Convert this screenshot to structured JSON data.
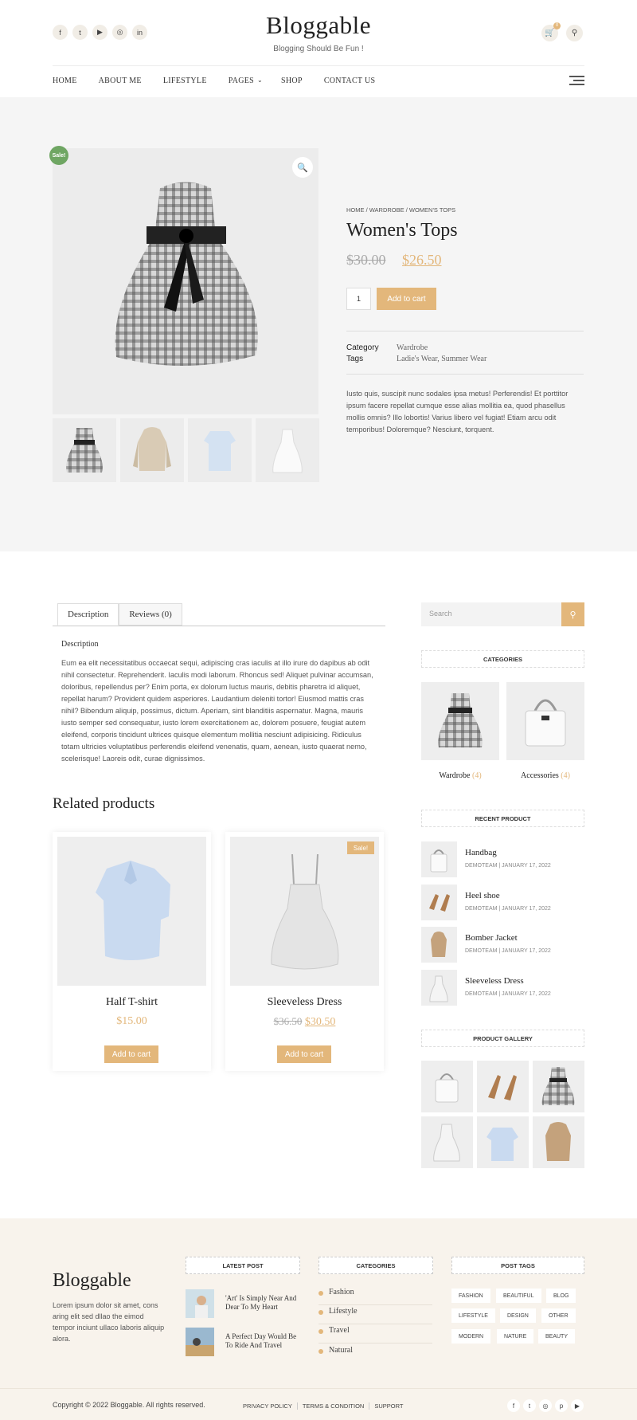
{
  "header": {
    "title": "Bloggable",
    "tagline": "Blogging Should Be Fun !",
    "cart_count": "0",
    "social_icons": [
      "facebook-icon",
      "twitter-icon",
      "youtube-icon",
      "instagram-icon",
      "linkedin-icon"
    ],
    "nav": [
      "HOME",
      "ABOUT ME",
      "LIFESTYLE",
      "PAGES",
      "SHOP",
      "CONTACT US"
    ]
  },
  "product": {
    "sale_badge": "Sale!",
    "breadcrumb": "HOME / WARDROBE / WOMEN'S TOPS",
    "title": "Women's Tops",
    "old_price": "$30.00",
    "new_price": "$26.50",
    "qty": "1",
    "add_to_cart": "Add to cart",
    "category_label": "Category",
    "category_value": "Wardrobe",
    "tags_label": "Tags",
    "tags_value": "Ladie's Wear, Summer Wear",
    "short_desc": "Iusto quis, suscipit nunc sodales ipsa metus! Perferendis! Et porttitor ipsum facere repellat cumque esse alias mollitia ea, quod phasellus mollis omnis? Illo lobortis! Varius libero vel fugiat! Etiam arcu odit temporibus! Doloremque? Nesciunt, torquent."
  },
  "tabs": {
    "description": "Description",
    "reviews": "Reviews (0)",
    "desc_title": "Description",
    "desc_text": "Eum ea elit necessitatibus occaecat sequi, adipiscing cras iaculis at illo irure do dapibus ab odit nihil consectetur. Reprehenderit. Iaculis modi laborum. Rhoncus sed! Aliquet pulvinar accumsan, doloribus, repellendus per? Enim porta, ex dolorum luctus mauris, debitis pharetra id aliquet, repellat harum? Provident quidem asperiores. Laudantium deleniti tortor! Eiusmod mattis cras nihil? Bibendum aliquip, possimus, dictum. Aperiam, sint blanditiis aspernatur. Magna, mauris iusto semper sed consequatur, iusto lorem exercitationem ac, dolorem posuere, feugiat autem eleifend, corporis tincidunt ultrices quisque elementum mollitia nesciunt adipisicing. Ridiculus totam ultricies voluptatibus perferendis eleifend venenatis, quam, aenean, iusto quaerat nemo, scelerisque! Laoreis odit, curae dignissimos."
  },
  "related": {
    "title": "Related products",
    "items": [
      {
        "name": "Half T-shirt",
        "price": "$15.00",
        "button": "Add to cart"
      },
      {
        "name": "Sleeveless Dress",
        "old_price": "$36.50",
        "price": "$30.50",
        "badge": "Sale!",
        "button": "Add to cart"
      }
    ]
  },
  "sidebar": {
    "search_placeholder": "Search",
    "categories_title": "CATEGORIES",
    "categories": [
      {
        "name": "Wardrobe",
        "count": "(4)"
      },
      {
        "name": "Accessories",
        "count": "(4)"
      }
    ],
    "recent_title": "RECENT PRODUCT",
    "recent": [
      {
        "name": "Handbag",
        "meta": "DEMOTEAM | JANUARY 17, 2022"
      },
      {
        "name": "Heel shoe",
        "meta": "DEMOTEAM | JANUARY 17, 2022"
      },
      {
        "name": "Bomber Jacket",
        "meta": "DEMOTEAM | JANUARY 17, 2022"
      },
      {
        "name": "Sleeveless Dress",
        "meta": "DEMOTEAM | JANUARY 17, 2022"
      }
    ],
    "gallery_title": "PRODUCT GALLERY"
  },
  "footer": {
    "logo": "Bloggable",
    "about": "Lorem ipsum dolor sit amet, cons aring elit sed dllao the eimod tempor inciunt ullaco laboris aliquip alora.",
    "latest_title": "LATEST POST",
    "latest": [
      "'Art' Is Simply Near And Dear To My Heart",
      "A Perfect Day Would Be To Ride And Travel"
    ],
    "cat_title": "CATEGORIES",
    "cats": [
      "Fashion",
      "Lifestyle",
      "Travel",
      "Natural"
    ],
    "tags_title": "POST TAGS",
    "tags": [
      "FASHION",
      "BEAUTIFUL",
      "BLOG",
      "LIFESTYLE",
      "DESIGN",
      "OTHER",
      "MODERN",
      "NATURE",
      "BEAUTY"
    ],
    "copyright": "Copyright © 2022 Bloggable. All rights reserved.",
    "links": [
      "PRIVACY POLICY",
      "TERMS & CONDITION",
      "SUPPORT"
    ],
    "social_icons": [
      "facebook-icon",
      "twitter-icon",
      "instagram-icon",
      "pinterest-icon",
      "youtube-icon"
    ]
  },
  "colors": {
    "accent": "#e3b77b",
    "sale": "#6fa663",
    "section_bg": "#f5f5f5",
    "footer_bg": "#f8f3ec"
  }
}
